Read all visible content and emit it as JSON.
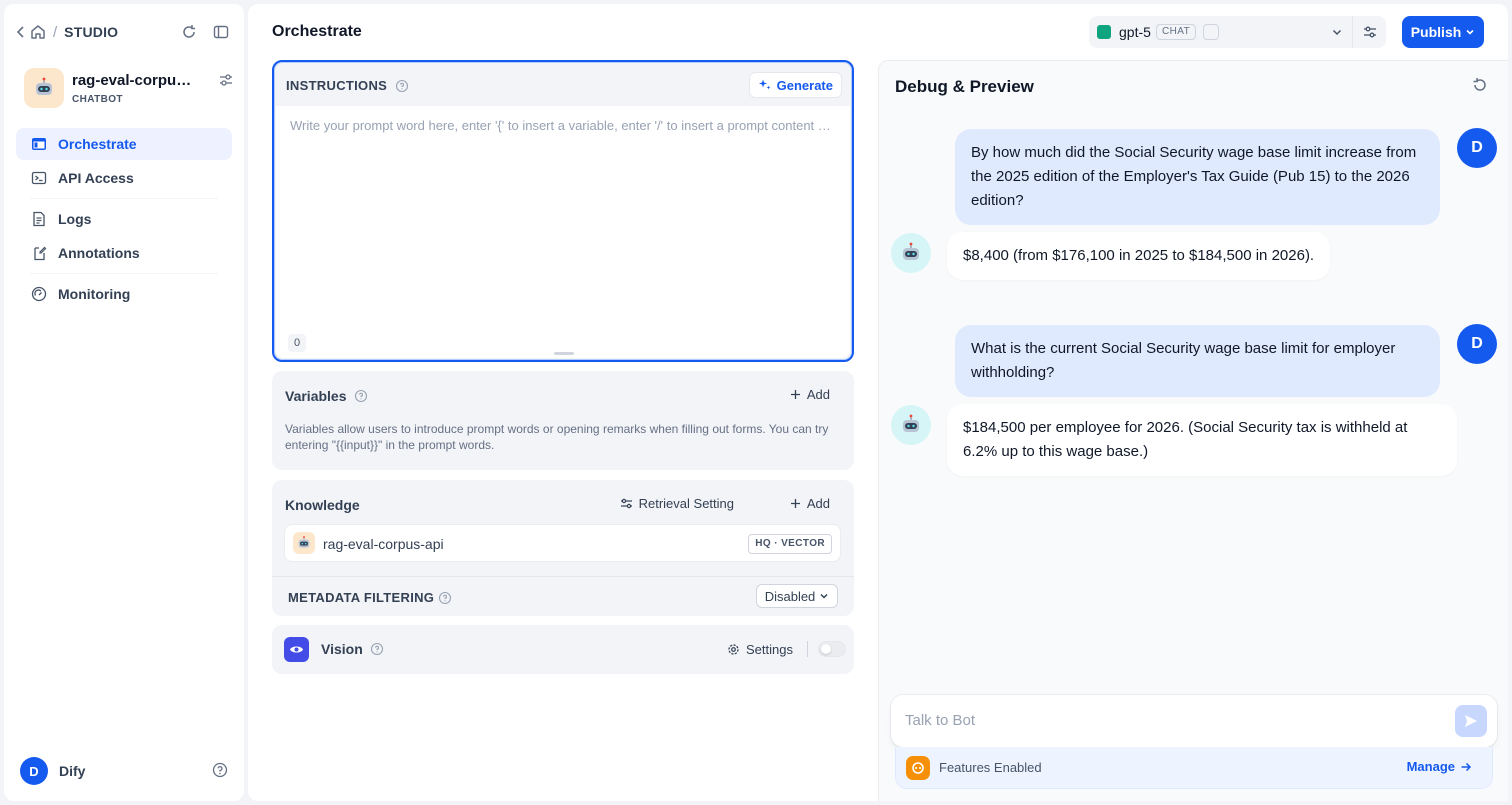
{
  "sidebar": {
    "section": "STUDIO",
    "app": {
      "name": "rag-eval-corpus-api",
      "type": "CHATBOT"
    },
    "items": [
      {
        "label": "Orchestrate"
      },
      {
        "label": "API Access"
      },
      {
        "label": "Logs"
      },
      {
        "label": "Annotations"
      },
      {
        "label": "Monitoring"
      }
    ],
    "user": {
      "initial": "D",
      "name": "Dify"
    }
  },
  "header": {
    "title": "Orchestrate",
    "model": {
      "name": "gpt-5",
      "tag": "CHAT"
    },
    "publish_label": "Publish"
  },
  "instructions": {
    "title": "INSTRUCTIONS",
    "generate_label": "Generate",
    "placeholder": "Write your prompt word here, enter '{' to insert a variable, enter '/' to insert a prompt content block",
    "count": "0"
  },
  "variables": {
    "title": "Variables",
    "add_label": "Add",
    "description": "Variables allow users to introduce prompt words or opening remarks when filling out forms. You can try entering \"{{input}}\" in the prompt words."
  },
  "knowledge": {
    "title": "Knowledge",
    "retrieval_label": "Retrieval Setting",
    "add_label": "Add",
    "dataset": {
      "name": "rag-eval-corpus-api",
      "tag": "HQ · VECTOR"
    },
    "metadata_title": "METADATA FILTERING",
    "metadata_value": "Disabled"
  },
  "vision": {
    "title": "Vision",
    "settings_label": "Settings",
    "enabled": false
  },
  "debug": {
    "title": "Debug & Preview",
    "messages": [
      {
        "role": "user",
        "avatar": "D",
        "text": "By how much did the Social Security wage base limit increase from the 2025 edition of the Employer's Tax Guide (Pub 15) to the 2026 edition?"
      },
      {
        "role": "bot",
        "text": "$8,400 (from $176,100 in 2025 to $184,500 in 2026)."
      },
      {
        "role": "user",
        "avatar": "D",
        "text": "What is the current Social Security wage base limit for employer withholding?"
      },
      {
        "role": "bot",
        "text": "$184,500 per employee for 2026. (Social Security tax is withheld at 6.2% up to this wage base.)"
      }
    ],
    "input_placeholder": "Talk to Bot",
    "features_label": "Features Enabled",
    "manage_label": "Manage"
  },
  "colors": {
    "accent": "#155aef",
    "user_bubble": "#e0eaff",
    "vision": "#444ce7",
    "features": "#f79009"
  }
}
